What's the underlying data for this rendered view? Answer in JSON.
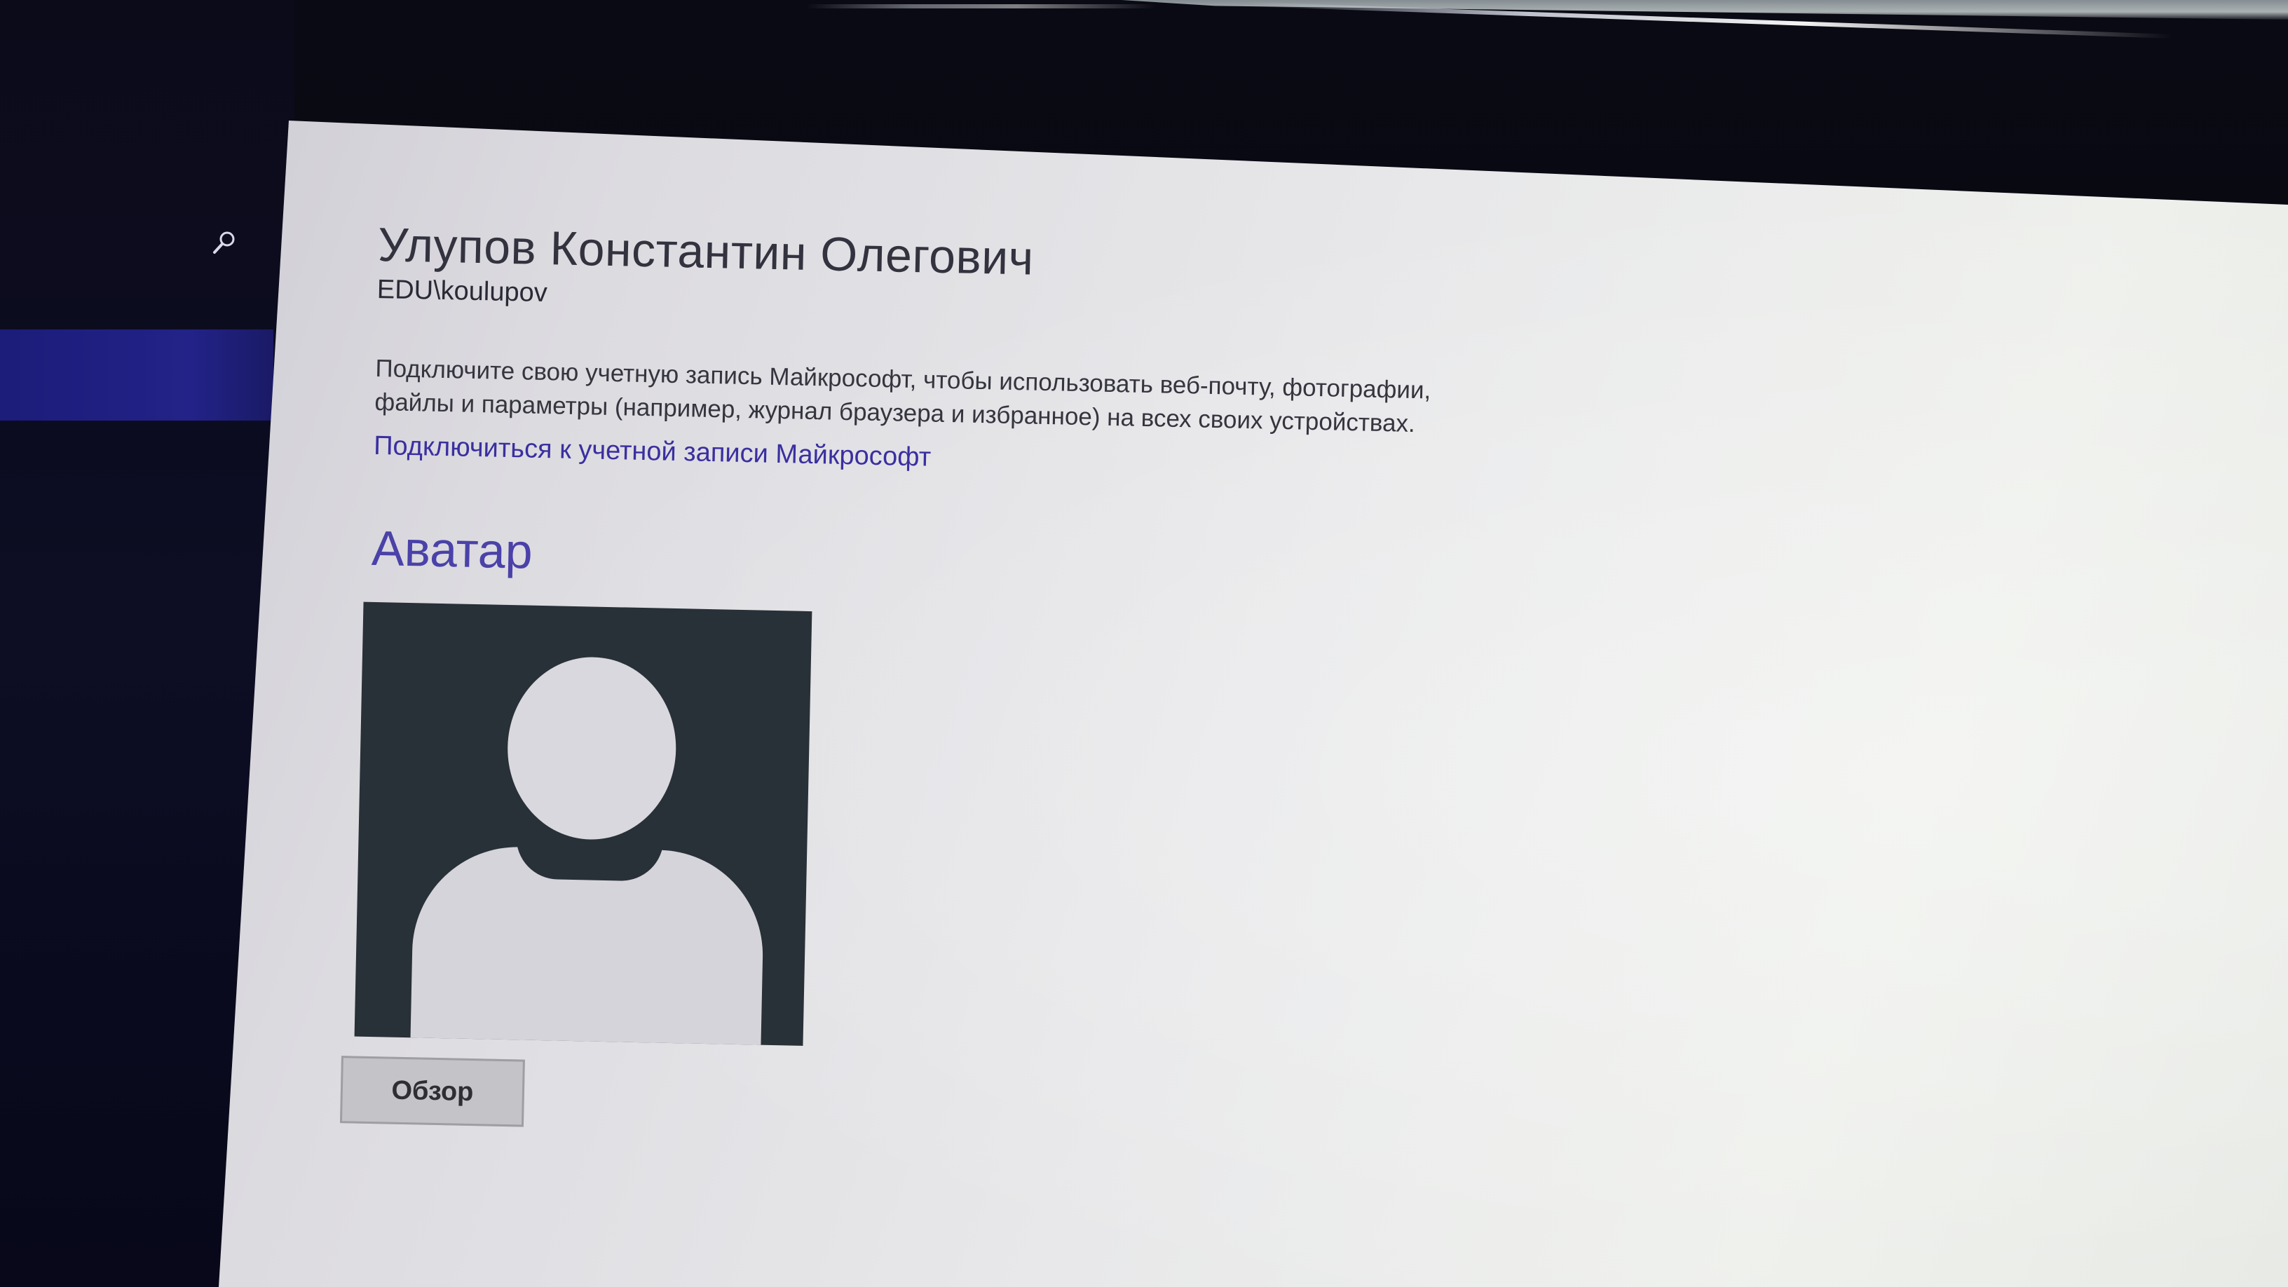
{
  "nav": {
    "search_icon": "search-icon"
  },
  "account": {
    "full_name": "Улупов Константин Олегович",
    "login": "EDU\\koulupov"
  },
  "microsoft_account": {
    "description": "Подключите свою учетную запись Майкрософт, чтобы использовать веб-почту, фотографии, файлы и параметры (например, журнал браузера и избранное) на всех своих устройствах.",
    "connect_link": "Подключиться к учетной записи Майкрософт"
  },
  "avatar": {
    "section_title": "Аватар",
    "browse_label": "Обзор"
  },
  "colors": {
    "nav_background": "#0b0b1a",
    "nav_selected": "#1c1c7a",
    "content_background": "#e4e4e8",
    "link": "#3a2fa0",
    "section_title": "#4a42a8",
    "avatar_background": "#283038"
  }
}
